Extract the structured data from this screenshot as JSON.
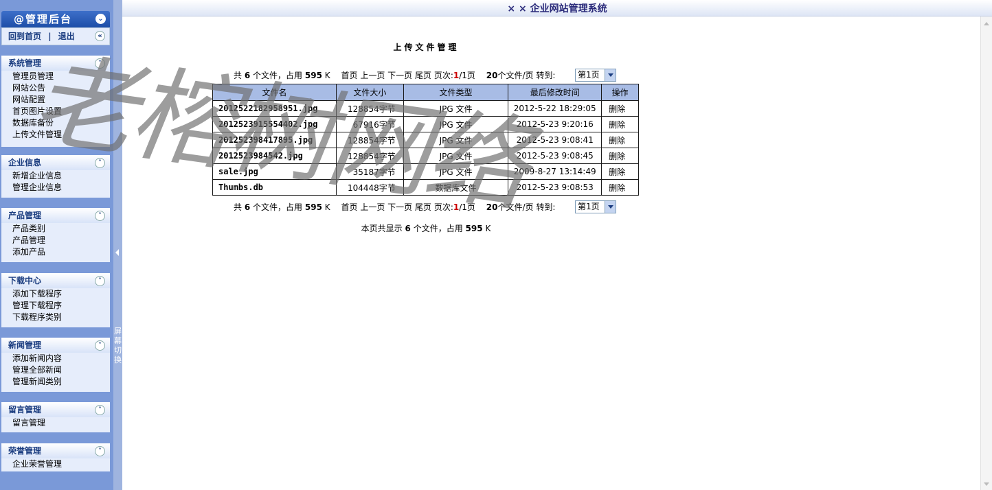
{
  "sidebar": {
    "title": "@管理后台",
    "collapse_icon": "chevron-double-down",
    "links": {
      "home": "回到首页",
      "separator": "|",
      "logout": "退出"
    },
    "groups": [
      {
        "title": "系统管理",
        "items": [
          "管理员管理",
          "网站公告",
          "网站配置",
          "首页图片设置",
          "数据库备份",
          "上传文件管理"
        ]
      },
      {
        "title": "企业信息",
        "items": [
          "新增企业信息",
          "管理企业信息"
        ]
      },
      {
        "title": "产品管理",
        "items": [
          "产品类别",
          "产品管理",
          "添加产品"
        ]
      },
      {
        "title": "下载中心",
        "items": [
          "添加下载程序",
          "管理下载程序",
          "下载程序类别"
        ]
      },
      {
        "title": "新闻管理",
        "items": [
          "添加新闻内容",
          "管理全部新闻",
          "管理新闻类别"
        ]
      },
      {
        "title": "留言管理",
        "items": [
          "留言管理"
        ]
      },
      {
        "title": "荣誉管理",
        "items": [
          "企业荣誉管理"
        ]
      }
    ]
  },
  "splitter": {
    "label": "屏幕切换"
  },
  "header": {
    "title": "× × 企业网站管理系统"
  },
  "main": {
    "title": "上传文件管理",
    "pager": {
      "prefix": "共",
      "file_count": "6",
      "files_unit": "个文件，占用",
      "total_size": "595",
      "size_unit": "K",
      "first": "首页",
      "prev": "上一页",
      "next": "下一页",
      "last": "尾页",
      "page_label": "页次:",
      "current_page": "1",
      "page_sep": "/1页",
      "per_page_num": "20",
      "per_page_unit": "个文件/页",
      "goto_label": "转到:",
      "goto_value": "第1页"
    },
    "table": {
      "headers": [
        "文件名",
        "文件大小",
        "文件类型",
        "最后修改时间",
        "操作"
      ],
      "rows": [
        [
          "2012522182958951.jpg",
          "128854字节",
          "JPG 文件",
          "2012-5-22 18:29:05",
          "删除"
        ],
        [
          "2012523915554402.jpg",
          "67916字节",
          "JPG 文件",
          "2012-5-23 9:20:16",
          "删除"
        ],
        [
          "201252398417895.jpg",
          "128854字节",
          "JPG 文件",
          "2012-5-23 9:08:41",
          "删除"
        ],
        [
          "2012523984542.jpg",
          "128854字节",
          "JPG 文件",
          "2012-5-23 9:08:45",
          "删除"
        ],
        [
          "sale.jpg",
          "35187字节",
          "JPG 文件",
          "2009-8-27 13:14:49",
          "删除"
        ],
        [
          "Thumbs.db",
          "104448字节",
          "数据库文件",
          "2012-5-23 9:08:53",
          "删除"
        ]
      ]
    },
    "summary": {
      "prefix": "本页共显示",
      "count": "6",
      "mid": "个文件，占用",
      "size": "595",
      "unit": "K"
    }
  },
  "watermark": {
    "text": "老榕树网络"
  },
  "colors": {
    "sidebar_bg": "#7A99D8",
    "table_header_bg": "#A8BCE5",
    "menu_title": "#1B3D80",
    "page_red": "#CC0000"
  }
}
